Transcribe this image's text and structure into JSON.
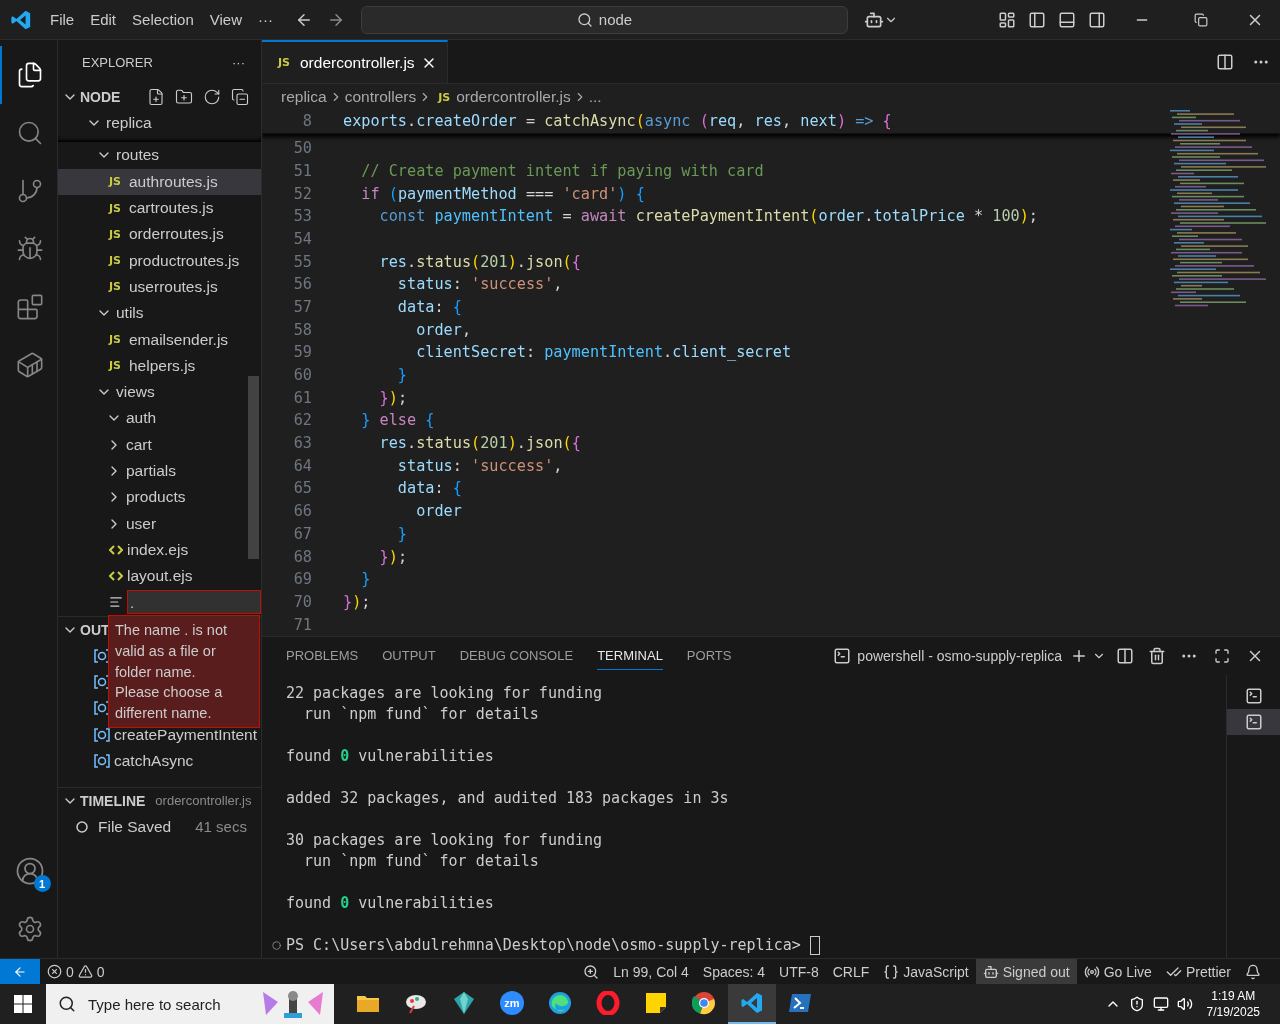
{
  "title_bar": {
    "menus": [
      "File",
      "Edit",
      "Selection",
      "View"
    ],
    "more": "···",
    "search": {
      "value": "node"
    }
  },
  "activity_bar": {
    "items": [
      {
        "kind": "files",
        "selected": true
      },
      {
        "kind": "search",
        "selected": false
      },
      {
        "kind": "source-control",
        "selected": false
      },
      {
        "kind": "run-debug",
        "selected": false
      },
      {
        "kind": "extensions",
        "selected": false
      },
      {
        "kind": "containers",
        "selected": false
      }
    ],
    "account_badge": "1"
  },
  "sidebar": {
    "title": "EXPLORER",
    "more": "···",
    "workspace": "NODE",
    "tree": [
      {
        "kind": "folder",
        "name": "replica",
        "expanded": true,
        "selected": false,
        "children": [
          {
            "kind": "folder",
            "name": "routes",
            "expanded": true,
            "selected": false,
            "children": [
              {
                "kind": "js",
                "badge": "JS",
                "name": "authroutes.js",
                "selected": true
              },
              {
                "kind": "js",
                "badge": "JS",
                "name": "cartroutes.js",
                "selected": false
              },
              {
                "kind": "js",
                "badge": "JS",
                "name": "orderroutes.js",
                "selected": false
              },
              {
                "kind": "js",
                "badge": "JS",
                "name": "productroutes.js",
                "selected": false
              },
              {
                "kind": "js",
                "badge": "JS",
                "name": "userroutes.js",
                "selected": false
              }
            ]
          },
          {
            "kind": "folder",
            "name": "utils",
            "expanded": true,
            "selected": false,
            "children": [
              {
                "kind": "js",
                "badge": "JS",
                "name": "emailsender.js",
                "selected": false
              },
              {
                "kind": "js",
                "badge": "JS",
                "name": "helpers.js",
                "selected": false
              }
            ]
          },
          {
            "kind": "folder",
            "name": "views",
            "expanded": true,
            "selected": false,
            "children": [
              {
                "kind": "folder",
                "name": "auth",
                "expanded": true,
                "selected": false
              },
              {
                "kind": "folder",
                "name": "cart",
                "expanded": false,
                "selected": false
              },
              {
                "kind": "folder",
                "name": "partials",
                "expanded": false,
                "selected": false
              },
              {
                "kind": "folder",
                "name": "products",
                "expanded": false,
                "selected": false
              },
              {
                "kind": "folder",
                "name": "user",
                "expanded": false,
                "selected": false
              },
              {
                "kind": "ejs",
                "name": "index.ejs",
                "selected": false
              },
              {
                "kind": "ejs",
                "name": "layout.ejs",
                "selected": false
              },
              {
                "kind": "new-file",
                "value": ".",
                "error": "The name . is not valid as a file or folder name. Please choose a different name."
              }
            ]
          }
        ]
      }
    ],
    "outline": {
      "title": "OUT",
      "expanded": true,
      "items": [
        {
          "kind": "variable"
        },
        {
          "kind": "variable"
        },
        {
          "kind": "variable"
        },
        {
          "kind": "variable",
          "name": "createPaymentIntent"
        },
        {
          "kind": "variable",
          "name": "catchAsync"
        }
      ]
    },
    "timeline": {
      "title": "TIMELINE",
      "file": "ordercontroller.js",
      "expanded": true,
      "items": [
        {
          "label": "File Saved",
          "time": "41 secs"
        }
      ]
    }
  },
  "editor": {
    "tabs": [
      {
        "badge": "JS",
        "label": "ordercontroller.js",
        "selected": true
      }
    ],
    "breadcrumbs": [
      {
        "label": "replica"
      },
      {
        "label": "controllers"
      },
      {
        "label": "ordercontroller.js",
        "badge": "JS"
      },
      {
        "label": "..."
      }
    ],
    "sticky_line": {
      "number": "8",
      "tokens": [
        {
          "kind": "var",
          "text": "exports"
        },
        {
          "kind": "plain",
          "text": "."
        },
        {
          "kind": "var",
          "text": "createOrder"
        },
        {
          "kind": "plain",
          "text": " = "
        },
        {
          "kind": "fn",
          "text": "catchAsync"
        },
        {
          "kind": "b1",
          "text": "("
        },
        {
          "kind": "keyword",
          "text": "async "
        },
        {
          "kind": "b2",
          "text": "("
        },
        {
          "kind": "var",
          "text": "req"
        },
        {
          "kind": "plain",
          "text": ", "
        },
        {
          "kind": "var",
          "text": "res"
        },
        {
          "kind": "plain",
          "text": ", "
        },
        {
          "kind": "var",
          "text": "next"
        },
        {
          "kind": "b2",
          "text": ")"
        },
        {
          "kind": "keyword",
          "text": " => "
        },
        {
          "kind": "b2",
          "text": "{"
        }
      ]
    },
    "lines": [
      {
        "number": "50"
      },
      {
        "number": "51",
        "tokens": [
          {
            "kind": "comment",
            "text": "  // Create payment intent if paying with card"
          }
        ]
      },
      {
        "number": "52",
        "tokens": [
          {
            "kind": "control",
            "text": "  if "
          },
          {
            "kind": "b3",
            "text": "("
          },
          {
            "kind": "var",
            "text": "paymentMethod"
          },
          {
            "kind": "plain",
            "text": " === "
          },
          {
            "kind": "str",
            "text": "'card'"
          },
          {
            "kind": "b3",
            "text": ")"
          },
          {
            "kind": "b3",
            "text": " {"
          }
        ]
      },
      {
        "number": "53",
        "tokens": [
          {
            "kind": "keyword",
            "text": "    const "
          },
          {
            "kind": "const",
            "text": "paymentIntent"
          },
          {
            "kind": "plain",
            "text": " = "
          },
          {
            "kind": "control",
            "text": "await "
          },
          {
            "kind": "fn",
            "text": "createPaymentIntent"
          },
          {
            "kind": "b1",
            "text": "("
          },
          {
            "kind": "var",
            "text": "order"
          },
          {
            "kind": "plain",
            "text": "."
          },
          {
            "kind": "var",
            "text": "totalPrice"
          },
          {
            "kind": "plain",
            "text": " * "
          },
          {
            "kind": "num",
            "text": "100"
          },
          {
            "kind": "b1",
            "text": ")"
          },
          {
            "kind": "plain",
            "text": ";"
          }
        ]
      },
      {
        "number": "54"
      },
      {
        "number": "55",
        "tokens": [
          {
            "kind": "var",
            "text": "    res"
          },
          {
            "kind": "plain",
            "text": "."
          },
          {
            "kind": "fn",
            "text": "status"
          },
          {
            "kind": "b1",
            "text": "("
          },
          {
            "kind": "num",
            "text": "201"
          },
          {
            "kind": "b1",
            "text": ")"
          },
          {
            "kind": "plain",
            "text": "."
          },
          {
            "kind": "fn",
            "text": "json"
          },
          {
            "kind": "b1",
            "text": "("
          },
          {
            "kind": "b2",
            "text": "{"
          }
        ]
      },
      {
        "number": "56",
        "tokens": [
          {
            "kind": "var",
            "text": "      status"
          },
          {
            "kind": "plain",
            "text": ": "
          },
          {
            "kind": "str",
            "text": "'success'"
          },
          {
            "kind": "plain",
            "text": ","
          }
        ]
      },
      {
        "number": "57",
        "tokens": [
          {
            "kind": "var",
            "text": "      data"
          },
          {
            "kind": "plain",
            "text": ": "
          },
          {
            "kind": "b3",
            "text": "{"
          }
        ]
      },
      {
        "number": "58",
        "tokens": [
          {
            "kind": "var",
            "text": "        order"
          },
          {
            "kind": "plain",
            "text": ","
          }
        ]
      },
      {
        "number": "59",
        "tokens": [
          {
            "kind": "var",
            "text": "        clientSecret"
          },
          {
            "kind": "plain",
            "text": ": "
          },
          {
            "kind": "const",
            "text": "paymentIntent"
          },
          {
            "kind": "plain",
            "text": "."
          },
          {
            "kind": "var",
            "text": "client_secret"
          }
        ]
      },
      {
        "number": "60",
        "tokens": [
          {
            "kind": "b3",
            "text": "      }"
          }
        ]
      },
      {
        "number": "61",
        "tokens": [
          {
            "kind": "b2",
            "text": "    }"
          },
          {
            "kind": "b1",
            "text": ")"
          },
          {
            "kind": "plain",
            "text": ";"
          }
        ]
      },
      {
        "number": "62",
        "tokens": [
          {
            "kind": "b3",
            "text": "  }"
          },
          {
            "kind": "control",
            "text": " else "
          },
          {
            "kind": "b3",
            "text": "{"
          }
        ]
      },
      {
        "number": "63",
        "tokens": [
          {
            "kind": "var",
            "text": "    res"
          },
          {
            "kind": "plain",
            "text": "."
          },
          {
            "kind": "fn",
            "text": "status"
          },
          {
            "kind": "b1",
            "text": "("
          },
          {
            "kind": "num",
            "text": "201"
          },
          {
            "kind": "b1",
            "text": ")"
          },
          {
            "kind": "plain",
            "text": "."
          },
          {
            "kind": "fn",
            "text": "json"
          },
          {
            "kind": "b1",
            "text": "("
          },
          {
            "kind": "b2",
            "text": "{"
          }
        ]
      },
      {
        "number": "64",
        "tokens": [
          {
            "kind": "var",
            "text": "      status"
          },
          {
            "kind": "plain",
            "text": ": "
          },
          {
            "kind": "str",
            "text": "'success'"
          },
          {
            "kind": "plain",
            "text": ","
          }
        ]
      },
      {
        "number": "65",
        "tokens": [
          {
            "kind": "var",
            "text": "      data"
          },
          {
            "kind": "plain",
            "text": ": "
          },
          {
            "kind": "b3",
            "text": "{"
          }
        ]
      },
      {
        "number": "66",
        "tokens": [
          {
            "kind": "var",
            "text": "        order"
          }
        ]
      },
      {
        "number": "67",
        "tokens": [
          {
            "kind": "b3",
            "text": "      }"
          }
        ]
      },
      {
        "number": "68",
        "tokens": [
          {
            "kind": "b2",
            "text": "    }"
          },
          {
            "kind": "b1",
            "text": ")"
          },
          {
            "kind": "plain",
            "text": ";"
          }
        ]
      },
      {
        "number": "69",
        "tokens": [
          {
            "kind": "b3",
            "text": "  }"
          }
        ]
      },
      {
        "number": "70",
        "tokens": [
          {
            "kind": "b2",
            "text": "}"
          },
          {
            "kind": "b1",
            "text": ")"
          },
          {
            "kind": "plain",
            "text": ";"
          }
        ]
      },
      {
        "number": "71"
      }
    ]
  },
  "panel": {
    "tabs": [
      {
        "label": "PROBLEMS",
        "selected": false
      },
      {
        "label": "OUTPUT",
        "selected": false
      },
      {
        "label": "DEBUG CONSOLE",
        "selected": false
      },
      {
        "label": "TERMINAL",
        "selected": true
      },
      {
        "label": "PORTS",
        "selected": false
      }
    ],
    "terminal_name": "powershell - osmo-supply-replica",
    "terminal_blocks": [
      [
        "22 packages are looking for funding",
        "  run `npm fund` for details"
      ],
      [
        "found **0** vulnerabilities"
      ],
      [
        "added 32 packages, and audited 183 packages in 3s"
      ],
      [
        "30 packages are looking for funding",
        "  run `npm fund` for details"
      ],
      [
        "found **0** vulnerabilities"
      ]
    ],
    "prompt": "PS C:\\Users\\abdulrehmna\\Desktop\\node\\osmo-supply-replica> ",
    "terminals": [
      {
        "selected": false
      },
      {
        "selected": true
      }
    ]
  },
  "status_bar": {
    "errors": "0",
    "warnings": "0",
    "items": [
      {
        "kind": "zoom",
        "highlighted": false
      },
      {
        "kind": "text",
        "label": "Ln 99, Col 4",
        "highlighted": false
      },
      {
        "kind": "text",
        "label": "Spaces: 4",
        "highlighted": false
      },
      {
        "kind": "text",
        "label": "UTF-8",
        "highlighted": false
      },
      {
        "kind": "text",
        "label": "CRLF",
        "highlighted": false
      },
      {
        "kind": "language",
        "label": "JavaScript",
        "highlighted": false
      },
      {
        "kind": "copilot",
        "label": "Signed out",
        "highlighted": true
      },
      {
        "kind": "live",
        "label": "Go Live",
        "highlighted": false
      },
      {
        "kind": "prettier",
        "label": "Prettier",
        "highlighted": false
      },
      {
        "kind": "bell",
        "highlighted": false
      }
    ]
  },
  "taskbar": {
    "search": {
      "placeholder": "Type here to search"
    },
    "apps": [
      {
        "kind": "folder",
        "active": false
      },
      {
        "kind": "paint",
        "active": false
      },
      {
        "kind": "gem",
        "active": false
      },
      {
        "kind": "zoom",
        "label": "zm",
        "active": false
      },
      {
        "kind": "edge",
        "active": false
      },
      {
        "kind": "opera",
        "active": false
      },
      {
        "kind": "notes",
        "active": false
      },
      {
        "kind": "chrome",
        "active": false
      },
      {
        "kind": "vscode",
        "active": true
      },
      {
        "kind": "powershell",
        "active": false
      }
    ],
    "time": "1:19 AM",
    "date": "7/19/2025"
  }
}
